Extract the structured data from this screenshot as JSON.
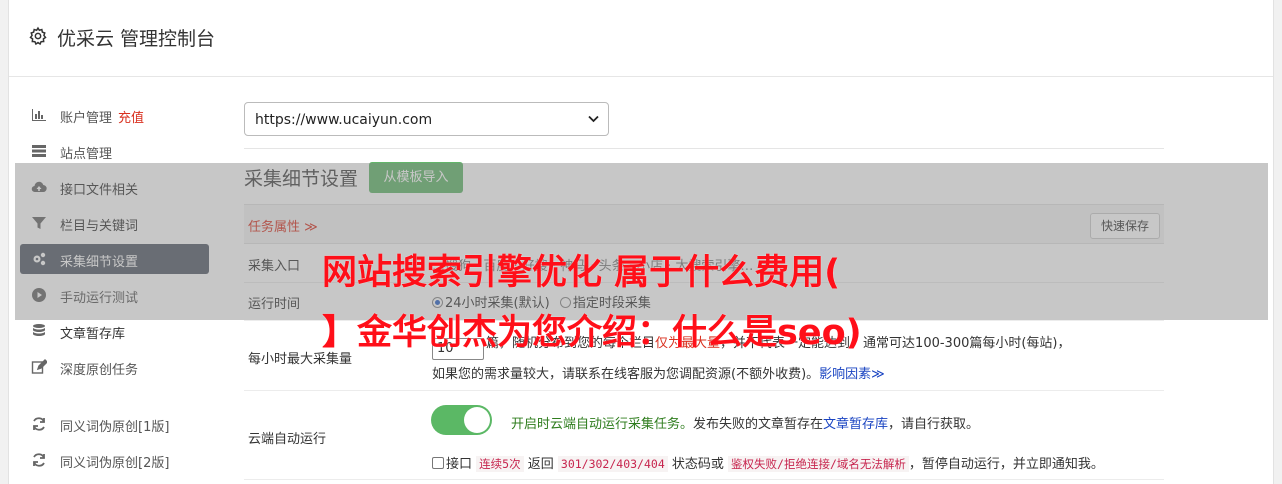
{
  "app": {
    "title": "优采云 管理控制台",
    "icon": "gear-icon"
  },
  "sidebar": {
    "items": [
      {
        "label": "账户管理",
        "extra": "充值",
        "icon": "bar-chart-icon"
      },
      {
        "label": "站点管理",
        "icon": "server-icon"
      },
      {
        "label": "接口文件相关",
        "icon": "cloud-upload-icon"
      },
      {
        "label": "栏目与关键词",
        "icon": "filter-icon"
      },
      {
        "label": "采集细节设置",
        "icon": "gears-icon",
        "active": true
      },
      {
        "label": "手动运行测试",
        "icon": "play-circle-icon"
      },
      {
        "label": "文章暂存库",
        "icon": "database-icon"
      },
      {
        "label": "深度原创任务",
        "icon": "edit-icon"
      },
      {
        "label": "同义词伪原创[1版]",
        "icon": "refresh-icon"
      },
      {
        "label": "同义词伪原创[2版]",
        "icon": "refresh-icon"
      }
    ]
  },
  "site_select": {
    "value": "https://www.ucaiyun.com"
  },
  "section": {
    "title": "采集细节设置",
    "template_button": "从模板导入"
  },
  "task_attr": {
    "label": "任务属性 ≫",
    "quick_save": "快速保存"
  },
  "rows": {
    "entry": {
      "label": "采集入口",
      "partial": "…搜狗 · 百度 · 好搜 · 神马 · 头条 · 小店 · 大搜索引擎…"
    },
    "runtime": {
      "label": "运行时间",
      "option1": "24小时采集(默认)",
      "option2": "指定时段采集"
    },
    "max_per_hour": {
      "label": "每小时最大采集量",
      "value": "10",
      "line1_pre": "篇，随机分布到您的每个栏目",
      "line1_red": "仅为最大量",
      "line1_mid": "，并不代表一定能达到",
      "line1_post": "，通常可达100-300篇每小时(每站)，",
      "line2": "如果您的需求量较大，请联系在线客服为您调配资源(不额外收费)。",
      "link": "影响因素≫"
    },
    "cloud_run": {
      "label": "云端自动运行",
      "toggle_on": true,
      "desc_green": "开启时云端自动运行采集任务。",
      "desc_mid": "发布失败的文章暂存在",
      "desc_link": "文章暂存库",
      "desc_post": "，请自行获取。",
      "cb_pre": "接口",
      "cb_code1": "连续5次",
      "cb_mid1": "返回",
      "cb_code2": "301/302/403/404",
      "cb_mid2": "状态码或",
      "cb_code3": "鉴权失败/拒绝连接/域名无法解析",
      "cb_post": "，暂停自动运行，并立即通知我。"
    }
  },
  "overlay": {
    "line1": "网站搜索引擎优化 属于什么费用(",
    "line2": "】金华创杰为您介绍：什么是seo)"
  },
  "colors": {
    "accent": "#555c68",
    "green": "#62b66a",
    "red": "#d9301f",
    "link": "#1a44c2"
  }
}
